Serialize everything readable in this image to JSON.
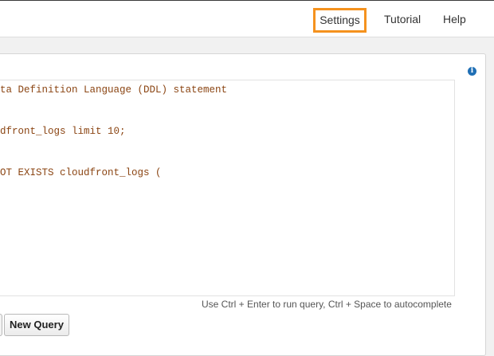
{
  "nav": {
    "settings_label": "Settings",
    "tutorial_label": "Tutorial",
    "help_label": "Help",
    "highlight_color": "#f5921e"
  },
  "info_icon": {
    "glyph": "i",
    "name": "info-icon",
    "color": "#1f6fb5"
  },
  "editor": {
    "lines": [
      "ta Definition Language (DDL) statement",
      "dfront_logs limit 10;",
      "OT EXISTS cloudfront_logs ("
    ],
    "text_color": "#8b4513"
  },
  "hint": "Use Ctrl + Enter to run query, Ctrl + Space to autocomplete",
  "buttons": {
    "new_query_label": "New Query"
  }
}
